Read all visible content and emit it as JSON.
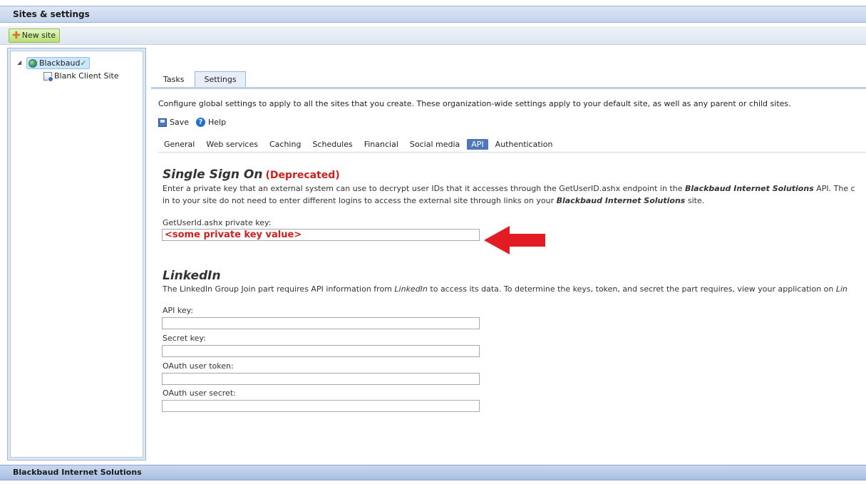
{
  "window": {
    "title": "Sites & settings"
  },
  "toolbar": {
    "new_site_label": "New site"
  },
  "tree": {
    "root_label": "Blackbaud",
    "root_check": "✓",
    "child_label": "Blank Client Site"
  },
  "tabs": [
    {
      "label": "Tasks",
      "active": false
    },
    {
      "label": "Settings",
      "active": true
    }
  ],
  "description": "Configure global settings to apply to all the sites that you create. These organization-wide settings apply to your default site, as well as any parent or child sites.",
  "actions": {
    "save": "Save",
    "help": "Help"
  },
  "subtabs": [
    {
      "label": "General",
      "active": false
    },
    {
      "label": "Web services",
      "active": false
    },
    {
      "label": "Caching",
      "active": false
    },
    {
      "label": "Schedules",
      "active": false
    },
    {
      "label": "Financial",
      "active": false
    },
    {
      "label": "Social media",
      "active": false
    },
    {
      "label": "API",
      "active": true
    },
    {
      "label": "Authentication",
      "active": false
    }
  ],
  "sso": {
    "title": "Single Sign On",
    "deprecated": "(Deprecated)",
    "line1_a": "Enter a private key that an external system can use to decrypt user IDs that it accesses through the GetUserID.ashx endpoint in the ",
    "line1_b": "Blackbaud Internet Solutions",
    "line1_c": " API. The c",
    "line2_a": "in to your site do not need to enter different logins to access the external site through links on your ",
    "line2_b": "Blackbaud Internet Solutions",
    "line2_c": " site.",
    "field_label": "GetUserId.ashx private key:",
    "field_value": "<some private key value>"
  },
  "linkedin": {
    "title": "LinkedIn",
    "line1_a": "The LinkedIn Group Join part requires API information from ",
    "line1_b": "LinkedIn",
    "line1_c": " to access its data. To determine the keys, token, and secret the part requires, view your application on ",
    "line1_d": "Lin",
    "fields": [
      {
        "label": "API key:",
        "value": ""
      },
      {
        "label": "Secret key:",
        "value": ""
      },
      {
        "label": "OAuth user token:",
        "value": ""
      },
      {
        "label": "OAuth user secret:",
        "value": ""
      }
    ]
  },
  "colors": {
    "annotation_arrow": "#e31b23",
    "deprecated": "#d01f1f",
    "active_subtab": "#4f78b8"
  },
  "footer": {
    "text": "Blackbaud Internet Solutions"
  }
}
